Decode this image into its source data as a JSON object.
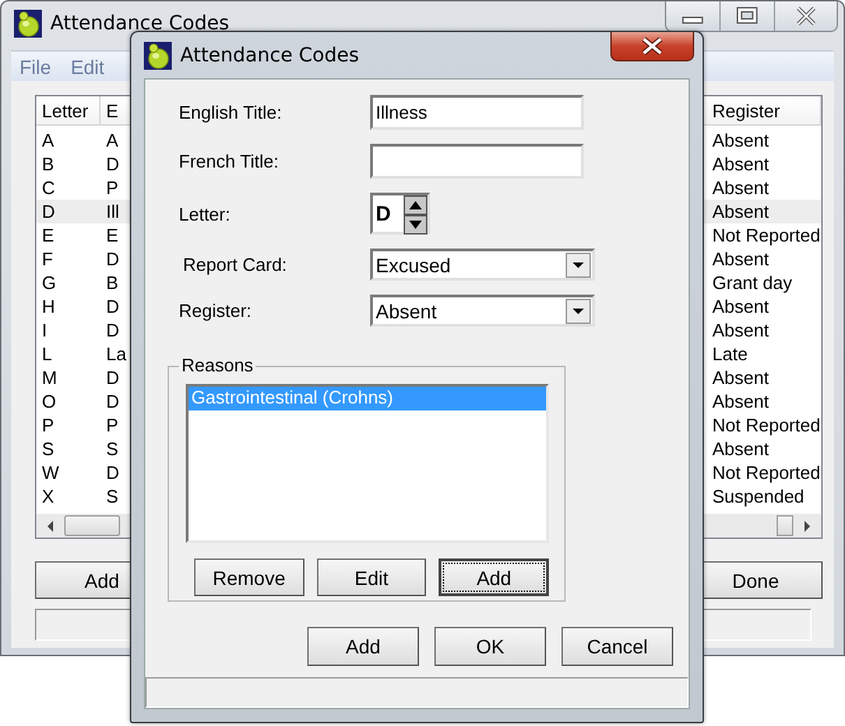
{
  "main_window": {
    "title": "Attendance Codes",
    "menu": [
      {
        "label": "File"
      },
      {
        "label": "Edit"
      }
    ],
    "list": {
      "columns": [
        "Letter",
        "E",
        "Register"
      ],
      "rows": [
        {
          "letter": "A",
          "column_2": "A",
          "register": "Absent",
          "selected": false
        },
        {
          "letter": "B",
          "column_2": "D",
          "register": "Absent",
          "selected": false
        },
        {
          "letter": "C",
          "column_2": "P",
          "register": "Absent",
          "selected": false
        },
        {
          "letter": "D",
          "column_2": "Ill",
          "register": "Absent",
          "selected": true
        },
        {
          "letter": "E",
          "column_2": "E",
          "register": "Not Reported",
          "selected": false
        },
        {
          "letter": "F",
          "column_2": "D",
          "register": "Absent",
          "selected": false
        },
        {
          "letter": "G",
          "column_2": "B",
          "register": "Grant day",
          "selected": false
        },
        {
          "letter": "H",
          "column_2": "D",
          "register": "Absent",
          "selected": false
        },
        {
          "letter": "I",
          "column_2": "D",
          "register": "Absent",
          "selected": false
        },
        {
          "letter": "L",
          "column_2": "La",
          "register": "Late",
          "selected": false
        },
        {
          "letter": "M",
          "column_2": "D",
          "register": "Absent",
          "selected": false
        },
        {
          "letter": "O",
          "column_2": "D",
          "register": "Absent",
          "selected": false
        },
        {
          "letter": "P",
          "column_2": "P",
          "register": "Not Reported",
          "selected": false
        },
        {
          "letter": "S",
          "column_2": "S",
          "register": "Absent",
          "selected": false
        },
        {
          "letter": "W",
          "column_2": "D",
          "register": "Not Reported",
          "selected": false
        },
        {
          "letter": "X",
          "column_2": "S",
          "register": "Suspended",
          "selected": false
        }
      ]
    },
    "buttons": [
      "Add",
      "Done"
    ]
  },
  "dialog": {
    "title": "Attendance Codes",
    "fields": [
      {
        "label": "English Title:",
        "value": "Illness"
      },
      {
        "label": "French Title:"
      }
    ],
    "letter": {
      "label": "Letter:",
      "value": "D"
    },
    "dropdowns": [
      {
        "label": "Report Card:",
        "value": "Excused"
      },
      {
        "label": "Register:",
        "value": "Absent"
      }
    ],
    "reasons": {
      "title": "Reasons",
      "items": [
        {
          "label": "Gastrointestinal (Crohns)",
          "selected": true
        }
      ],
      "buttons": [
        {
          "label": "Remove",
          "focused": false
        },
        {
          "label": "Edit",
          "focused": false
        },
        {
          "label": "Add",
          "focused": true
        }
      ]
    },
    "buttons": [
      "Add",
      "OK",
      "Cancel"
    ]
  }
}
